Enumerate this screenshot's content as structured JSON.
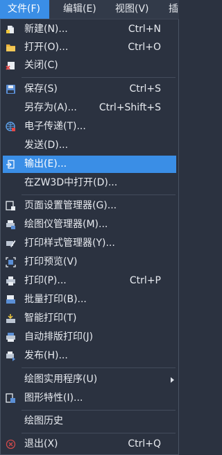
{
  "menubar": {
    "items": [
      "文件(F)",
      "编辑(E)",
      "视图(V)",
      "插"
    ]
  },
  "menu": {
    "items": [
      {
        "label": "新建(N)...",
        "shortcut": "Ctrl+N",
        "icon": "new-file-icon"
      },
      {
        "label": "打开(O)...",
        "shortcut": "Ctrl+O",
        "icon": "open-folder-icon"
      },
      {
        "label": "关闭(C)",
        "shortcut": "",
        "icon": "close-file-icon"
      },
      {
        "label": "保存(S)",
        "shortcut": "Ctrl+S",
        "icon": "save-icon"
      },
      {
        "label": "另存为(A)...",
        "shortcut": "Ctrl+Shift+S",
        "icon": ""
      },
      {
        "label": "电子传递(T)...",
        "shortcut": "",
        "icon": "etransmit-icon"
      },
      {
        "label": "发送(D)...",
        "shortcut": "",
        "icon": ""
      },
      {
        "label": "输出(E)...",
        "shortcut": "",
        "icon": "export-icon"
      },
      {
        "label": "在ZW3D中打开(D)...",
        "shortcut": "",
        "icon": ""
      },
      {
        "label": "页面设置管理器(G)...",
        "shortcut": "",
        "icon": "page-setup-icon"
      },
      {
        "label": "绘图仪管理器(M)...",
        "shortcut": "",
        "icon": "plotter-manager-icon"
      },
      {
        "label": "打印样式管理器(Y)...",
        "shortcut": "",
        "icon": "plot-style-icon"
      },
      {
        "label": "打印预览(V)",
        "shortcut": "",
        "icon": "print-preview-icon"
      },
      {
        "label": "打印(P)...",
        "shortcut": "Ctrl+P",
        "icon": "print-icon"
      },
      {
        "label": "批量打印(B)...",
        "shortcut": "",
        "icon": "batch-print-icon"
      },
      {
        "label": "智能打印(T)",
        "shortcut": "",
        "icon": "smart-print-icon"
      },
      {
        "label": "自动排版打印(J)",
        "shortcut": "",
        "icon": "auto-layout-print-icon"
      },
      {
        "label": "发布(H)...",
        "shortcut": "",
        "icon": "publish-icon"
      },
      {
        "label": "绘图实用程序(U)",
        "shortcut": "",
        "icon": ""
      },
      {
        "label": "图形特性(I)...",
        "shortcut": "",
        "icon": "drawing-properties-icon"
      },
      {
        "label": "绘图历史",
        "shortcut": "",
        "icon": ""
      },
      {
        "label": "退出(X)",
        "shortcut": "Ctrl+Q",
        "icon": "exit-icon"
      }
    ]
  },
  "colors": {
    "accent": "#3a8ee6",
    "background": "#2b3240",
    "text": "#e8ebf0"
  }
}
